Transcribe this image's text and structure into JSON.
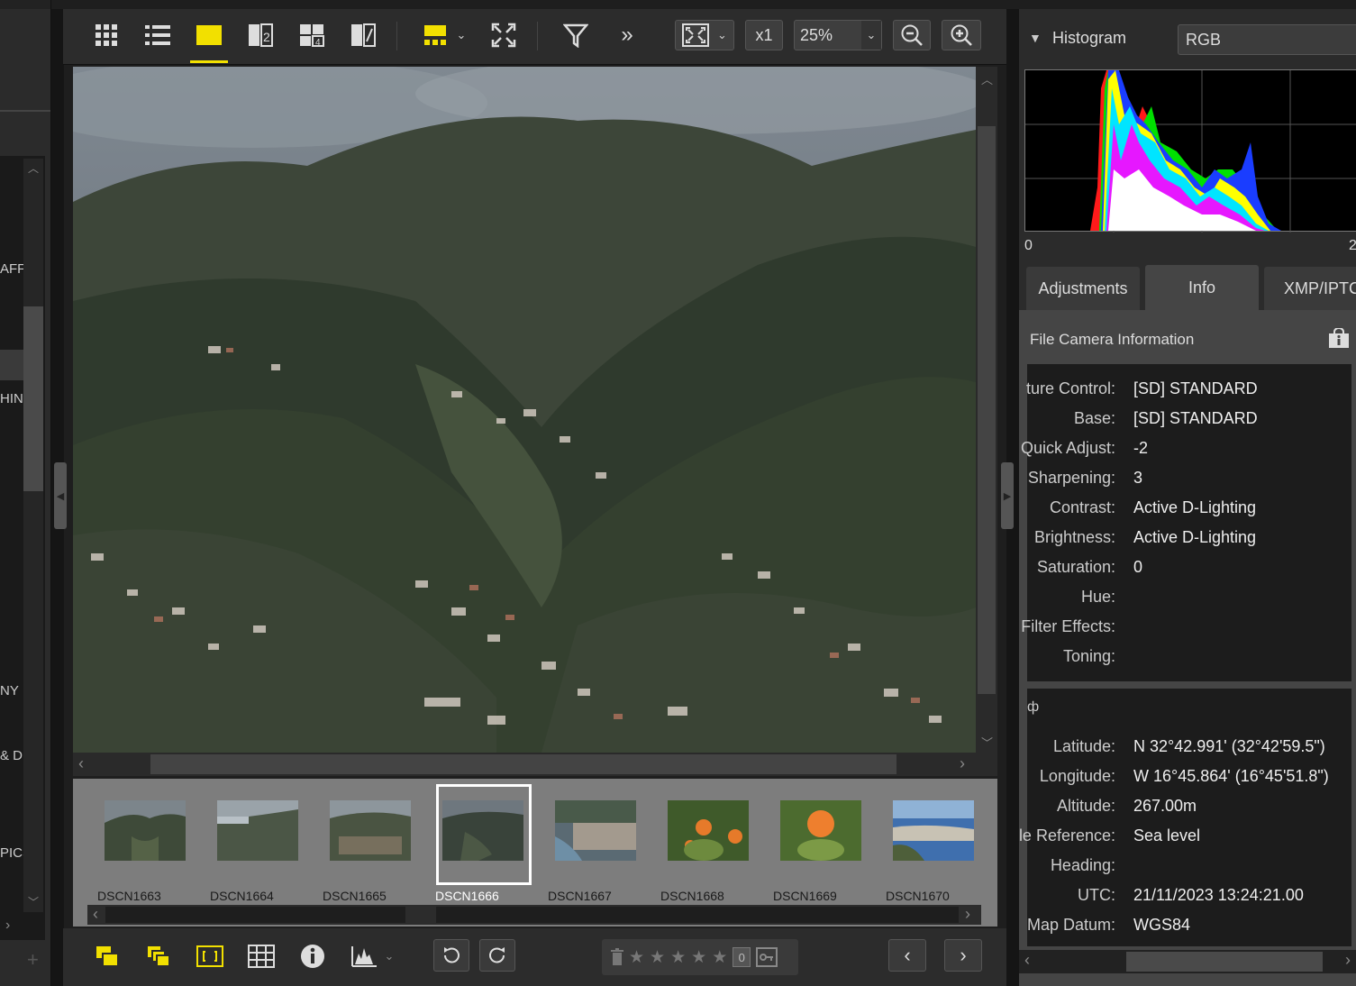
{
  "left_panel": {
    "labels": [
      "AFFI",
      "HIN",
      "NY",
      "& D",
      "PICS"
    ]
  },
  "toolbar": {
    "zoom_multiplier": "x1",
    "zoom_level": "25%"
  },
  "filmstrip": {
    "items": [
      "DSCN1663",
      "DSCN1664",
      "DSCN1665",
      "DSCN1666",
      "DSCN1667",
      "DSCN1668",
      "DSCN1669",
      "DSCN1670"
    ],
    "selected": "DSCN1666"
  },
  "bottombar": {
    "rating_count": "0"
  },
  "histogram": {
    "title": "Histogram",
    "channel": "RGB",
    "axis_min": "0",
    "axis_max": "2"
  },
  "tabs": [
    "Adjustments",
    "Info",
    "XMP/IPTC"
  ],
  "info": {
    "header": "File  Camera Information",
    "picture_control_rows": [
      {
        "key": "ture Control:",
        "value": "[SD] STANDARD"
      },
      {
        "key": "Base:",
        "value": "[SD] STANDARD"
      },
      {
        "key": "Quick Adjust:",
        "value": "-2"
      },
      {
        "key": "Sharpening:",
        "value": "3"
      },
      {
        "key": "Contrast:",
        "value": "Active D-Lighting"
      },
      {
        "key": "Brightness:",
        "value": "Active D-Lighting"
      },
      {
        "key": "Saturation:",
        "value": "0"
      },
      {
        "key": "Hue:",
        "value": ""
      },
      {
        "key": "Filter Effects:",
        "value": ""
      },
      {
        "key": "Toning:",
        "value": ""
      }
    ],
    "gps_heading": "ф",
    "gps_rows": [
      {
        "key": "Latitude:",
        "value": "N 32°42.991' (32°42'59.5\")"
      },
      {
        "key": "Longitude:",
        "value": "W 16°45.864' (16°45'51.8\")"
      },
      {
        "key": "Altitude:",
        "value": "267.00m"
      },
      {
        "key": "le Reference:",
        "value": "Sea level"
      },
      {
        "key": "Heading:",
        "value": ""
      },
      {
        "key": "UTC:",
        "value": "21/11/2023 13:24:21.00"
      },
      {
        "key": "Map Datum:",
        "value": "WGS84"
      }
    ]
  }
}
